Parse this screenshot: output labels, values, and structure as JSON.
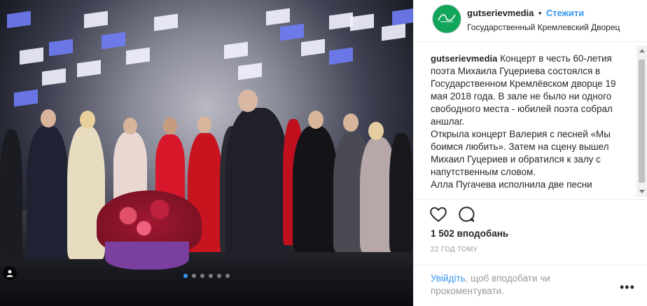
{
  "post": {
    "username": "gutserievmedia",
    "separator": "•",
    "follow_label": "Стежити",
    "location": "Государственный Кремлевский Дворец",
    "avatar_icon": "gutseriev-logo",
    "brand_color": "#11a55a"
  },
  "caption": {
    "author": "gutserievmedia",
    "paragraphs": [
      "Концерт в честь 60-летия поэта Михаила Гуцериева состоялся в Государственном Кремлёвском дворце 19 мая 2018 года. В зале не было ни одного свободного места - юбилей поэта собрал аншлаг.",
      "Открыла концерт Валерия с песней «Мы боимся любить». Затем на сцену вышел Михаил Гуцериев и обратился к залу с напутственным словом.",
      "Алла Пугачева исполнила две песни"
    ]
  },
  "actions": {
    "like_icon": "heart-outline-icon",
    "comment_icon": "speech-bubble-icon",
    "likes_text": "1 502 вподобань",
    "time_text": "22 ГОД ТОМУ"
  },
  "footer": {
    "login_link": "Увійдіть",
    "login_rest": ", щоб вподобати чи прокоментувати.",
    "more_label": "•••"
  },
  "carousel": {
    "total": 6,
    "active_index": 0,
    "active_color": "#3897f0"
  }
}
